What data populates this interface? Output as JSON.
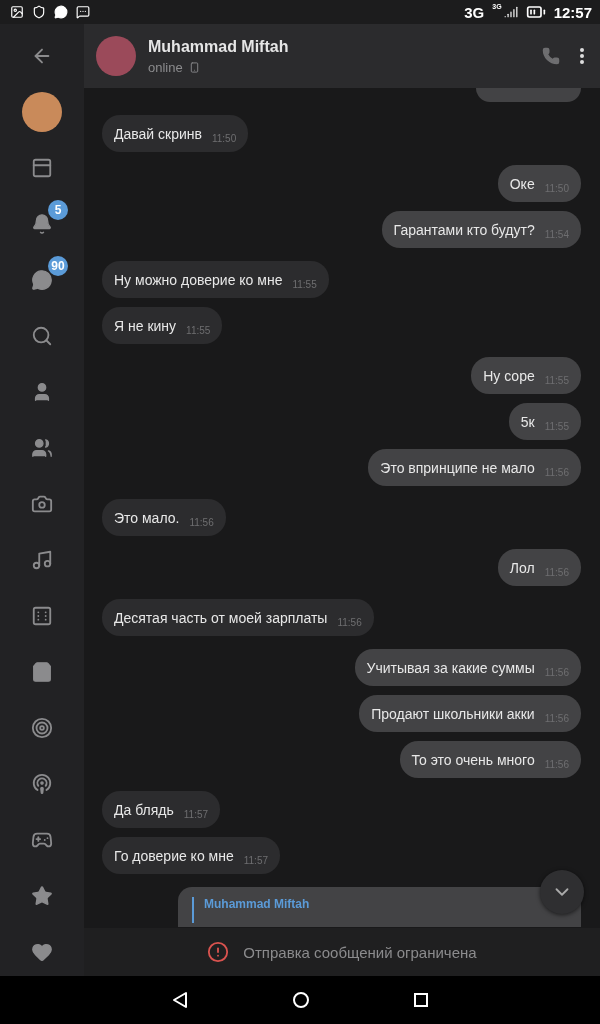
{
  "status_bar": {
    "network": "3G",
    "network_small": "3G",
    "time": "12:57"
  },
  "sidebar": {
    "items": [
      {
        "kind": "back"
      },
      {
        "kind": "avatar"
      },
      {
        "kind": "news"
      },
      {
        "kind": "bell",
        "badge": "5"
      },
      {
        "kind": "chat",
        "badge": "90"
      },
      {
        "kind": "search"
      },
      {
        "kind": "person"
      },
      {
        "kind": "people"
      },
      {
        "kind": "camera"
      },
      {
        "kind": "music"
      },
      {
        "kind": "dice"
      },
      {
        "kind": "bag"
      },
      {
        "kind": "target"
      },
      {
        "kind": "podcast"
      },
      {
        "kind": "gamepad"
      },
      {
        "kind": "star"
      },
      {
        "kind": "heart"
      }
    ]
  },
  "header": {
    "name": "Muhammad Miftah",
    "status": "online"
  },
  "messages": [
    {
      "kind": "cutoff",
      "outgoing": true
    },
    {
      "kind": "text",
      "outgoing": false,
      "text": "Давай скринв",
      "time": "11:50"
    },
    {
      "kind": "text",
      "outgoing": true,
      "text": "Оке",
      "time": "11:50"
    },
    {
      "kind": "text",
      "outgoing": true,
      "text": "Гарантами кто будут?",
      "time": "11:54"
    },
    {
      "kind": "text",
      "outgoing": false,
      "text": "Ну можно доверие ко мне",
      "time": "11:55"
    },
    {
      "kind": "text",
      "outgoing": false,
      "text": "Я не кину",
      "time": "11:55"
    },
    {
      "kind": "text",
      "outgoing": true,
      "text": "Ну соре",
      "time": "11:55"
    },
    {
      "kind": "text",
      "outgoing": true,
      "text": "5к",
      "time": "11:55"
    },
    {
      "kind": "text",
      "outgoing": true,
      "text": "Это впринципе не мало",
      "time": "11:56"
    },
    {
      "kind": "text",
      "outgoing": false,
      "text": "Это мало.",
      "time": "11:56"
    },
    {
      "kind": "text",
      "outgoing": true,
      "text": "Лол",
      "time": "11:56"
    },
    {
      "kind": "text",
      "outgoing": false,
      "text": "Десятая часть от моей зарплаты",
      "time": "11:56"
    },
    {
      "kind": "text",
      "outgoing": true,
      "text": "Учитывая за какие суммы",
      "time": "11:56"
    },
    {
      "kind": "text",
      "outgoing": true,
      "text": "Продают школьники акки",
      "time": "11:56"
    },
    {
      "kind": "text",
      "outgoing": true,
      "text": "То это очень много",
      "time": "11:56"
    },
    {
      "kind": "text",
      "outgoing": false,
      "text": "Да блядь",
      "time": "11:57"
    },
    {
      "kind": "text",
      "outgoing": false,
      "text": "Го доверие ко мне",
      "time": "11:57"
    },
    {
      "kind": "reply",
      "outgoing": true,
      "reply_to": "Muhammad Miftah"
    }
  ],
  "notice": "Отправка сообщений ограничена"
}
